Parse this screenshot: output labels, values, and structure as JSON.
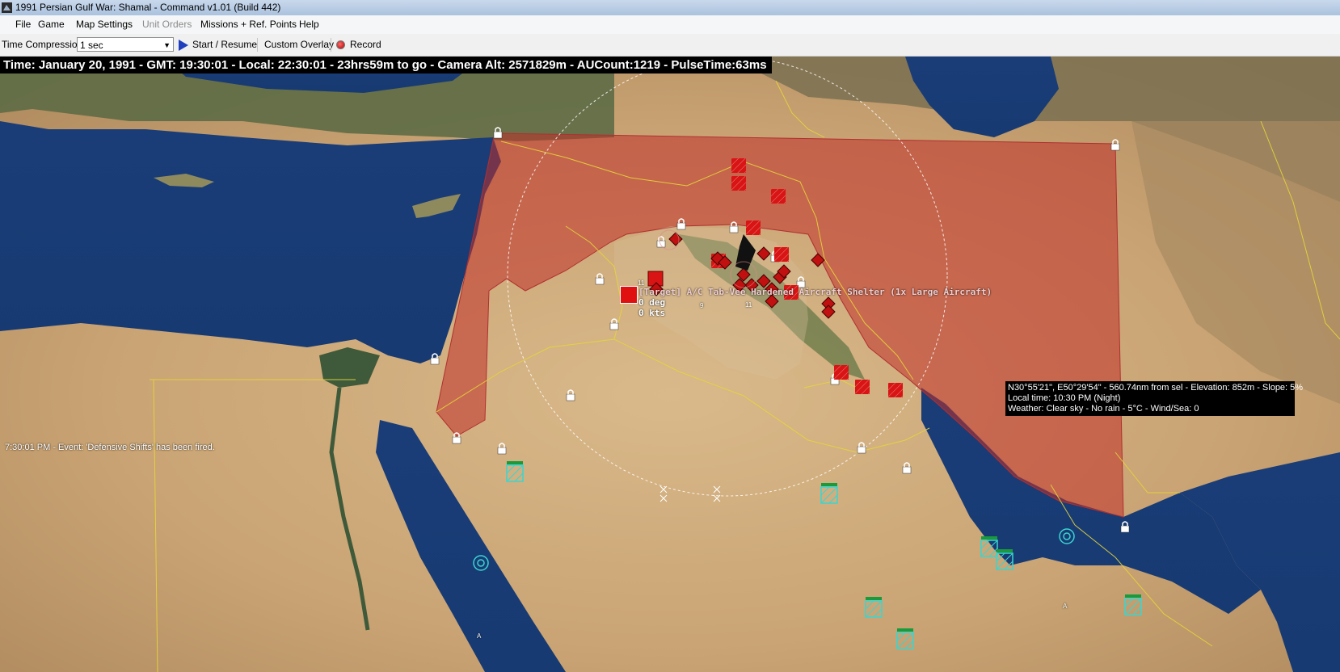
{
  "window": {
    "title": "1991 Persian Gulf War: Shamal - Command v1.01 (Build 442)",
    "icon": "app-icon"
  },
  "menu": [
    {
      "label": "File",
      "enabled": true
    },
    {
      "label": "Game",
      "enabled": true
    },
    {
      "label": "Map Settings",
      "enabled": true
    },
    {
      "label": "Unit Orders",
      "enabled": false
    },
    {
      "label": "Missions + Ref. Points",
      "enabled": true
    },
    {
      "label": "Help",
      "enabled": true
    }
  ],
  "toolbar": {
    "time_compression_label": "Time Compression:",
    "time_compression_value": "1 sec",
    "start_resume_label": "Start / Resume",
    "custom_overlay_label": "Custom Overlay",
    "record_label": "Record"
  },
  "status": {
    "text": "Time: January 20, 1991 - GMT: 19:30:01 - Local: 22:30:01 - 23hrs59m to go -  Camera Alt: 2571829m - AUCount:1219 - PulseTime:63ms"
  },
  "event_log": "7:30:01 PM - Event: 'Defensive Shifts' has been fired.",
  "selected_unit": {
    "name": "[Target] A/C Tab-Vee Hardened Aircraft Shelter (1x Large Aircraft)",
    "heading": "0 deg",
    "speed": "0 kts",
    "count_badge": "11"
  },
  "cursor_info": {
    "line1": "N30°55'21\", E50°29'54\" - 560.74nm from sel - Elevation: 852m - Slope: 5%",
    "line2": "Local time: 10:30 PM (Night)",
    "line3": "Weather: Clear sky - No rain - 5°C - Wind/Sea: 0"
  },
  "colors": {
    "hostile": "#d81414",
    "friendly": "#39d6d0",
    "zone_fill": "#c0302a",
    "border": "#e5d63a",
    "sea": "#1b3f7a",
    "desert": "#c9a97a"
  },
  "map_labels": {
    "carrier_label": "A",
    "unit_count_9": "9",
    "unit_count_11": "11"
  }
}
